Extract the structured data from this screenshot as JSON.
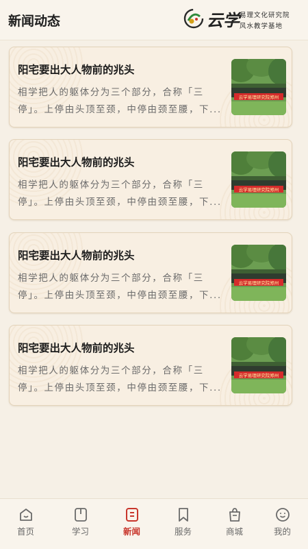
{
  "header": {
    "title": "新闻动态",
    "logo": {
      "mark_text": "云学",
      "line1": "易理文化研究院",
      "line2": "风水教学基地"
    }
  },
  "news": [
    {
      "title": "阳宅要出大人物前的兆头",
      "summary": "相学把人的躯体分为三个部分，合称「三停」。上停由头顶至颈，中停由颈至腰，下...",
      "banner_text": "云学易理研究院郑州"
    },
    {
      "title": "阳宅要出大人物前的兆头",
      "summary": "相学把人的躯体分为三个部分，合称「三停」。上停由头顶至颈，中停由颈至腰，下...",
      "banner_text": "云学易理研究院郑州"
    },
    {
      "title": "阳宅要出大人物前的兆头",
      "summary": "相学把人的躯体分为三个部分，合称「三停」。上停由头顶至颈，中停由颈至腰，下...",
      "banner_text": "云学易理研究院郑州"
    },
    {
      "title": "阳宅要出大人物前的兆头",
      "summary": "相学把人的躯体分为三个部分，合称「三停」。上停由头顶至颈，中停由颈至腰，下...",
      "banner_text": "云学易理研究院郑州"
    }
  ],
  "tabbar": {
    "items": [
      {
        "label": "首页",
        "icon": "home-icon",
        "active": false
      },
      {
        "label": "学习",
        "icon": "book-icon",
        "active": false
      },
      {
        "label": "新闻",
        "icon": "news-icon",
        "active": true
      },
      {
        "label": "服务",
        "icon": "bookmark-icon",
        "active": false
      },
      {
        "label": "商城",
        "icon": "shop-icon",
        "active": false
      },
      {
        "label": "我的",
        "icon": "profile-icon",
        "active": false
      }
    ]
  },
  "colors": {
    "accent": "#c8352b",
    "background": "#f6f0e6",
    "card": "#f8efe2",
    "inactive_tab": "#6a6a6a"
  }
}
